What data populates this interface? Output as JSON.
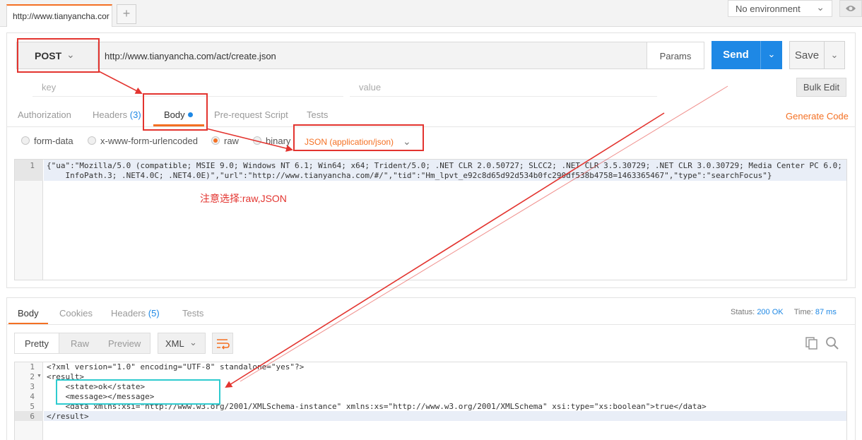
{
  "tab": {
    "url_label": "http://www.tianyancha.cor",
    "new_tab_label": "+"
  },
  "environment": {
    "label": "No environment"
  },
  "request": {
    "method": "POST",
    "url": "http://www.tianyancha.com/act/create.json",
    "params_label": "Params",
    "send_label": "Send",
    "save_label": "Save",
    "key_placeholder": "key",
    "value_placeholder": "value",
    "bulk_edit_label": "Bulk Edit",
    "tabs": [
      {
        "label": "Authorization"
      },
      {
        "label": "Headers",
        "badge": "(3)"
      },
      {
        "label": "Body"
      },
      {
        "label": "Pre-request Script"
      },
      {
        "label": "Tests"
      }
    ],
    "generate_code_label": "Generate Code",
    "body_modes": [
      {
        "label": "form-data",
        "selected": false
      },
      {
        "label": "x-www-form-urlencoded",
        "selected": false
      },
      {
        "label": "raw",
        "selected": true
      },
      {
        "label": "binary",
        "selected": false
      }
    ],
    "content_type": "JSON (application/json)",
    "body_line_number": "1",
    "body_line_1": "{\"ua\":\"Mozilla/5.0 (compatible; MSIE 9.0; Windows NT 6.1; Win64; x64; Trident/5.0; .NET CLR 2.0.50727; SLCC2; .NET CLR 3.5.30729; .NET CLR 3.0.30729; Media Center PC 6.0;",
    "body_line_1b": "    InfoPath.3; .NET4.0C; .NET4.0E)\",\"url\":\"http://www.tianyancha.com/#/\",\"tid\":\"Hm_lpvt_e92c8d65d92d534b0fc290df538b4758=1463365467\",\"type\":\"searchFocus\"}"
  },
  "annotation": {
    "note": "注意选择:raw,JSON"
  },
  "response": {
    "tabs": [
      {
        "label": "Body"
      },
      {
        "label": "Cookies"
      },
      {
        "label": "Headers",
        "badge": "(5)"
      },
      {
        "label": "Tests"
      }
    ],
    "status_label": "Status:",
    "status_value": "200 OK",
    "time_label": "Time:",
    "time_value": "87 ms",
    "formats": [
      "Pretty",
      "Raw",
      "Preview"
    ],
    "language": "XML",
    "lines": [
      {
        "n": "1",
        "text": "<?xml version=\"1.0\" encoding=\"UTF-8\" standalone=\"yes\"?>"
      },
      {
        "n": "2",
        "text": "<result>"
      },
      {
        "n": "3",
        "text": "    <state>ok</state>"
      },
      {
        "n": "4",
        "text": "    <message></message>"
      },
      {
        "n": "5",
        "text": "    <data xmlns:xsi=\"http://www.w3.org/2001/XMLSchema-instance\" xmlns:xs=\"http://www.w3.org/2001/XMLSchema\" xsi:type=\"xs:boolean\">true</data>"
      },
      {
        "n": "6",
        "text": "</result>"
      }
    ]
  },
  "colors": {
    "accent_orange": "#f47023",
    "send_blue": "#1e88e5",
    "annotation_red": "#e3342f",
    "annotation_cyan": "#2ecbcf"
  },
  "icons": [
    "chevron-down-icon",
    "eye-icon",
    "wrap-lines-icon",
    "copy-icon",
    "search-icon"
  ]
}
